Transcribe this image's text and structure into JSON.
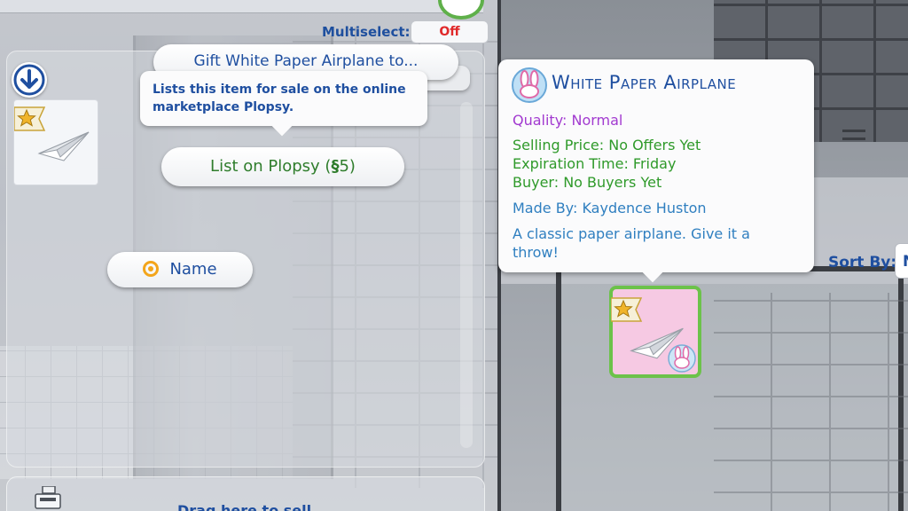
{
  "left_panel": {
    "multiselect": {
      "label": "Multiselect:",
      "value": "Off"
    },
    "drop_zone_text": "Drag here to sell"
  },
  "pie_menu": {
    "gift_label": "Gift White Paper Airplane to...",
    "tooltip": "Lists this item for sale on the online marketplace Plopsy.",
    "list_label": "List on Plopsy (",
    "list_currency": "§",
    "list_price": "5",
    "list_close": ")",
    "name_label": "Name"
  },
  "item_tooltip": {
    "title": "White Paper Airplane",
    "quality": "Quality: Normal",
    "selling_price": "Selling Price: No Offers Yet",
    "expiration": "Expiration Time: Friday",
    "buyer": "Buyer: No Buyers Yet",
    "made_by": "Made By: Kaydence Huston",
    "description": "A classic paper airplane. Give it a throw!"
  },
  "right_panel": {
    "sort_label": "Sort By:",
    "sort_value": "N"
  },
  "colors": {
    "accent_blue": "#1f4fa0",
    "off_red": "#e0292a",
    "action_green": "#2f7d2c",
    "quality_purple": "#a23ad0",
    "selected_border": "#6cc24a",
    "item_pink": "#f6c9e3"
  },
  "icons": [
    "arrow-down-icon",
    "star-tag-icon",
    "paper-airplane-icon",
    "radio-target-icon",
    "simoleon-icon",
    "bunny-icon",
    "cash-register-icon",
    "menu-lines-icon"
  ]
}
